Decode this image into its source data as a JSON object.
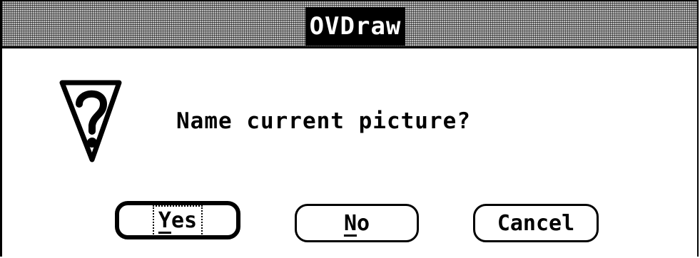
{
  "window": {
    "title": "OVDraw"
  },
  "icon": "question-mark-warning-icon",
  "message": "Name current picture?",
  "buttons": [
    {
      "id": "yes",
      "first": "Y",
      "rest": "es",
      "default": true
    },
    {
      "id": "no",
      "first": "N",
      "rest": "o",
      "default": false
    },
    {
      "id": "cancel",
      "label": "Cancel",
      "default": false
    }
  ]
}
